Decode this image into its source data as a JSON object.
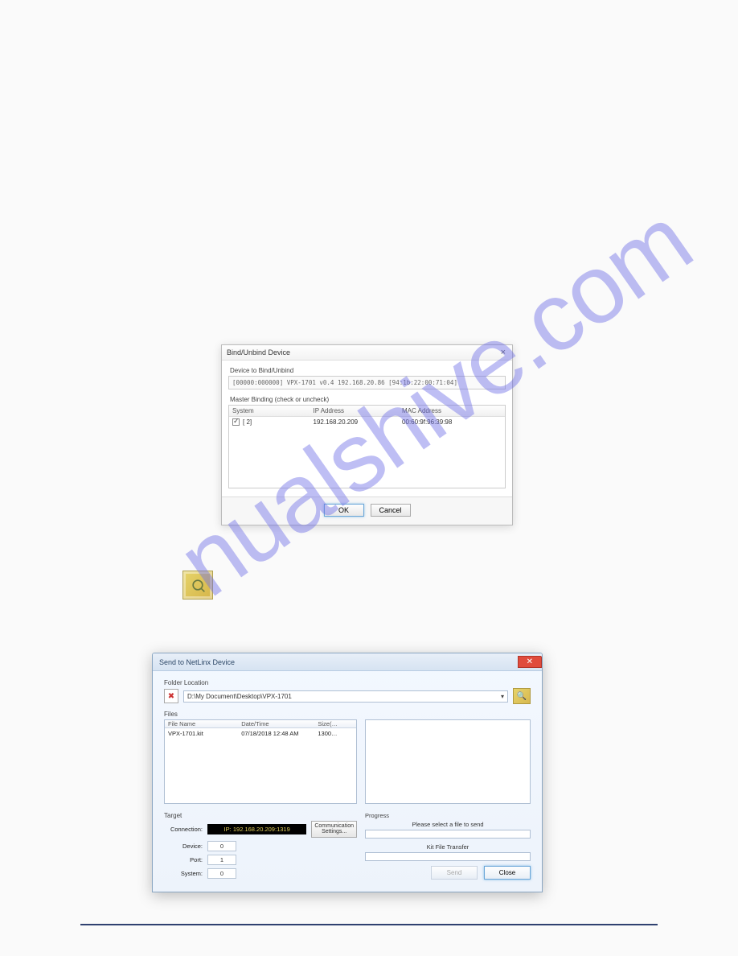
{
  "watermark": "nualshive.com",
  "dialog1": {
    "title": "Bind/Unbind Device",
    "deviceLabel": "Device to Bind/Unbind",
    "deviceLine": "[00000:000000] VPX-1701  v0.4   192.168.20.86   [94:1b:22:00:71:04]",
    "bindingLabel": "Master Binding (check or uncheck)",
    "headers": {
      "system": "System",
      "ip": "IP Address",
      "mac": "MAC Address"
    },
    "rows": [
      {
        "system": "[   2]",
        "ip": "192.168.20.209",
        "mac": "00:60:9f:96:39:98"
      }
    ],
    "okLabel": "OK",
    "cancelLabel": "Cancel"
  },
  "dialog2": {
    "title": "Send to NetLinx Device",
    "folderLabel": "Folder Location",
    "folderPath": "D:\\My Document\\Desktop\\VPX-1701",
    "filesLabel": "Files",
    "fileHeaders": {
      "name": "File Name",
      "date": "Date/Time",
      "size": "Size(…"
    },
    "fileRows": [
      {
        "name": "VPX-1701.kit",
        "date": "07/18/2018  12:48 AM",
        "size": "1300…"
      }
    ],
    "targetLabel": "Target",
    "connLabel": "Connection:",
    "connValue": "IP: 192.168.20.209:1319",
    "commBtnLine1": "Communication",
    "commBtnLine2": "Settings...",
    "deviceLabel": "Device:",
    "deviceValue": "0",
    "portLabel": "Port:",
    "portValue": "1",
    "systemLabel": "System:",
    "systemValue": "0",
    "progressLabel": "Progress",
    "progressMsg1": "Please select a file to send",
    "progressMsg2": "Kit File Transfer",
    "sendLabel": "Send",
    "closeLabel": "Close"
  }
}
